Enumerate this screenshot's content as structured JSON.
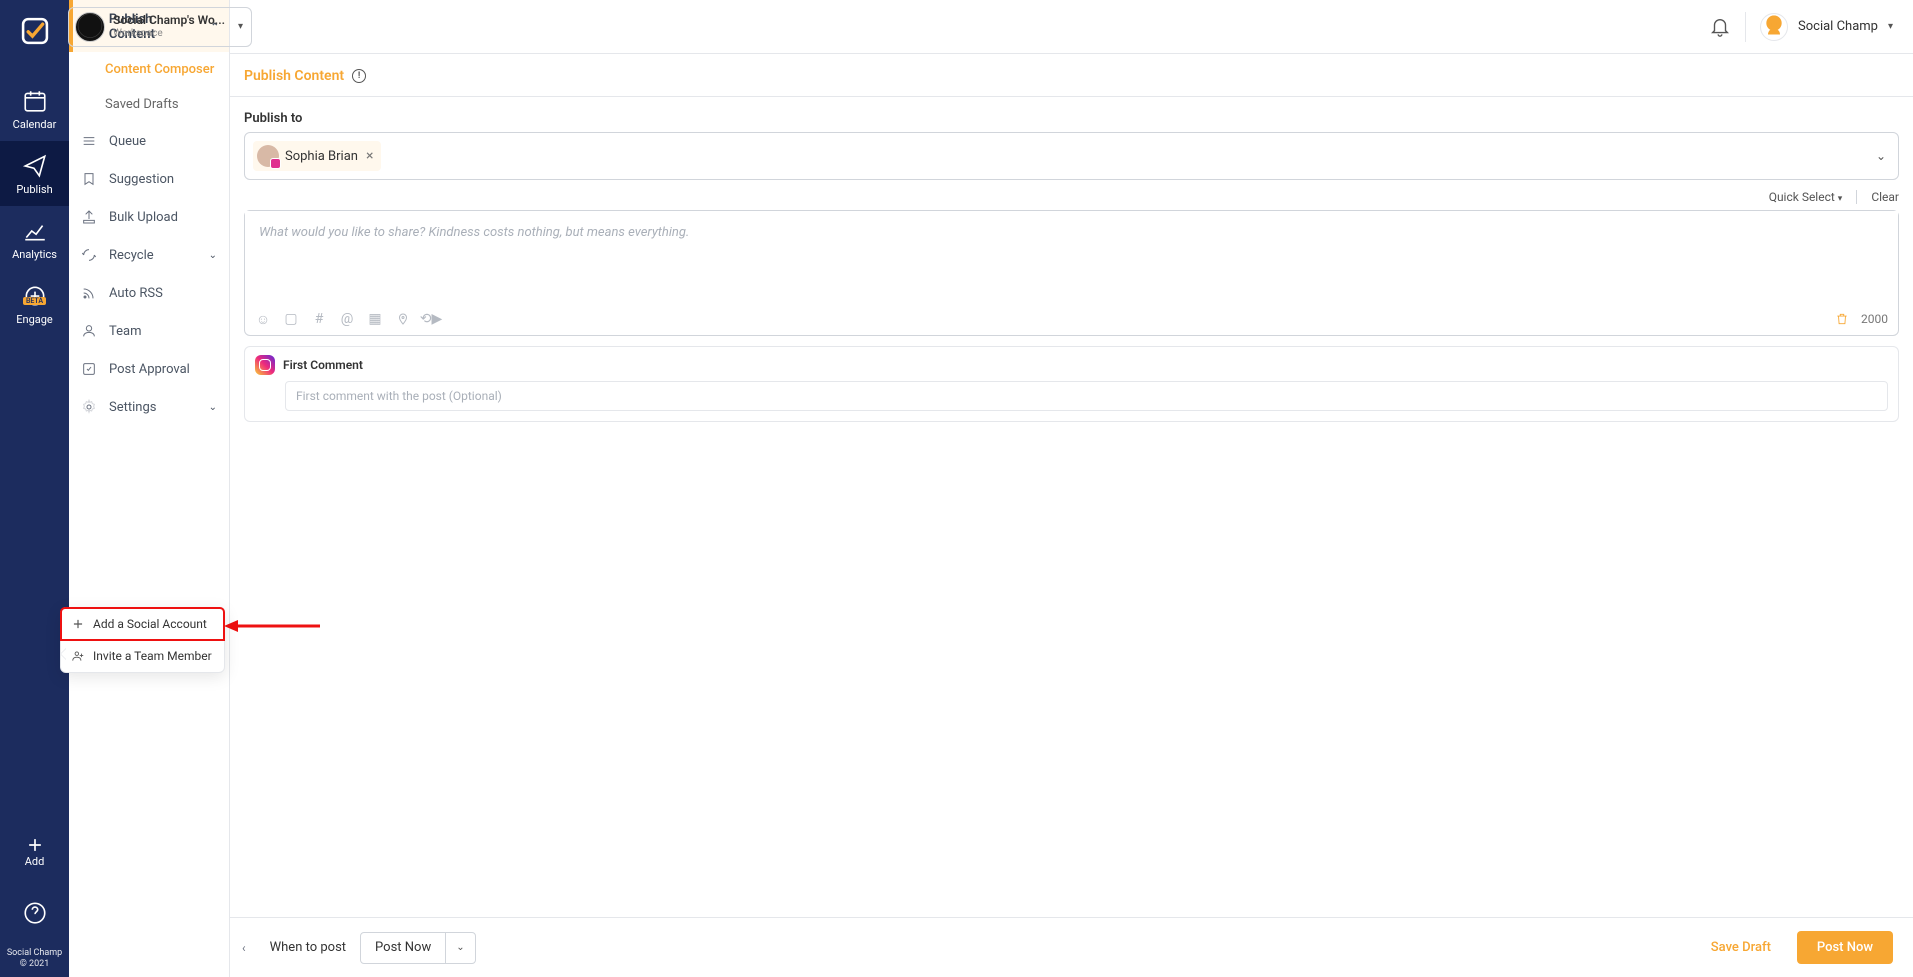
{
  "rail": {
    "items": [
      {
        "label": "Calendar"
      },
      {
        "label": "Publish"
      },
      {
        "label": "Analytics"
      },
      {
        "label": "Engage",
        "badge": "BETA"
      }
    ],
    "add_label": "Add",
    "brand_line1": "Social Champ",
    "brand_line2": "© 2021"
  },
  "sidebar": {
    "publish_content": "Publish Content",
    "sub": [
      {
        "label": "Content Composer"
      },
      {
        "label": "Saved Drafts"
      }
    ],
    "items": [
      {
        "label": "Queue"
      },
      {
        "label": "Suggestion"
      },
      {
        "label": "Bulk Upload"
      },
      {
        "label": "Recycle",
        "caret": true
      },
      {
        "label": "Auto RSS"
      },
      {
        "label": "Team"
      },
      {
        "label": "Post Approval"
      },
      {
        "label": "Settings",
        "caret": true
      }
    ]
  },
  "topbar": {
    "workspace_title": "Social Champ's Wo...",
    "workspace_sub": "Workspace",
    "user_name": "Social Champ"
  },
  "page": {
    "title": "Publish Content",
    "publish_to_label": "Publish to",
    "profile_name": "Sophia Brian",
    "quick_select": "Quick Select",
    "clear": "Clear",
    "composer_placeholder": "What would you like to share? Kindness costs nothing, but means everything.",
    "char_count": "2000",
    "first_comment_label": "First Comment",
    "first_comment_placeholder": "First comment with the post (Optional)"
  },
  "popover": {
    "add_social": "Add a Social Account",
    "invite_team": "Invite a Team Member"
  },
  "footer": {
    "when_label": "When to post",
    "when_value": "Post Now",
    "save_draft": "Save Draft",
    "post_now": "Post Now"
  }
}
